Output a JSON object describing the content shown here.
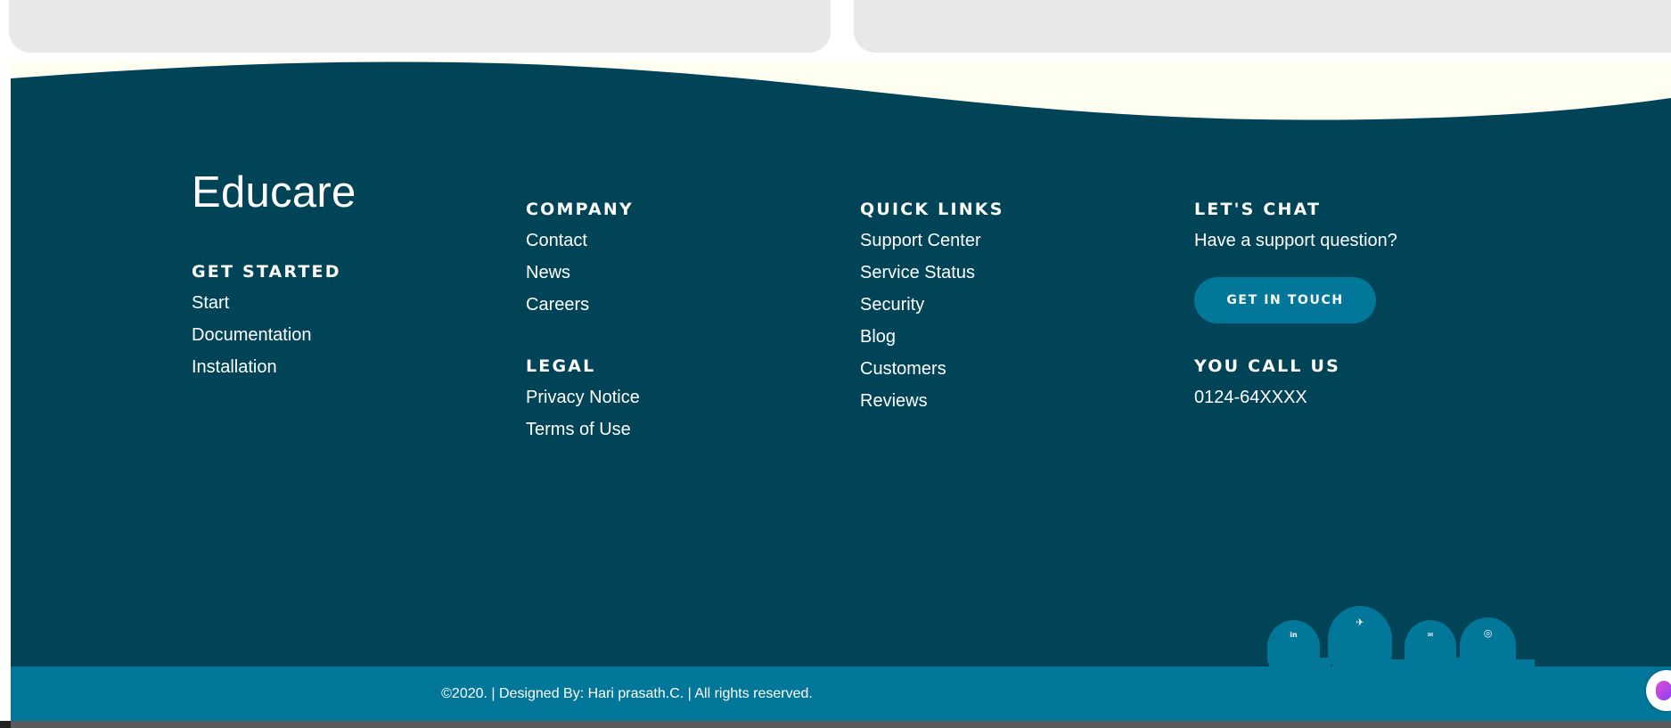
{
  "footer": {
    "brand": "Educare",
    "get_started": {
      "heading": "GET STARTED",
      "links": [
        "Start",
        "Documentation",
        "Installation"
      ]
    },
    "company": {
      "heading": "COMPANY",
      "links": [
        "Contact",
        "News",
        "Careers"
      ]
    },
    "legal": {
      "heading": "LEGAL",
      "links": [
        "Privacy Notice",
        "Terms of Use"
      ]
    },
    "quick_links": {
      "heading": "QUICK LINKS",
      "links": [
        "Support Center",
        "Service Status",
        "Security",
        "Blog",
        "Customers",
        "Reviews"
      ]
    },
    "chat": {
      "heading": "LET'S CHAT",
      "question": "Have a support question?",
      "button": "GET IN TOUCH"
    },
    "call": {
      "heading": "YOU CALL US",
      "phone": "0124-64XXXX"
    },
    "socials": [
      {
        "icon": "linkedin-icon",
        "glyph": "in"
      },
      {
        "icon": "twitter-icon",
        "glyph": "✈"
      },
      {
        "icon": "email-icon",
        "glyph": "✉"
      },
      {
        "icon": "github-icon",
        "glyph": "◎"
      }
    ],
    "copyright": "©2020. | Designed By: Hari prasath.C. | All rights reserved."
  },
  "colors": {
    "footer_bg": "#024457",
    "accent": "#037799",
    "wave_cream": "#fefef1",
    "card_grey": "#e8e8e8"
  }
}
